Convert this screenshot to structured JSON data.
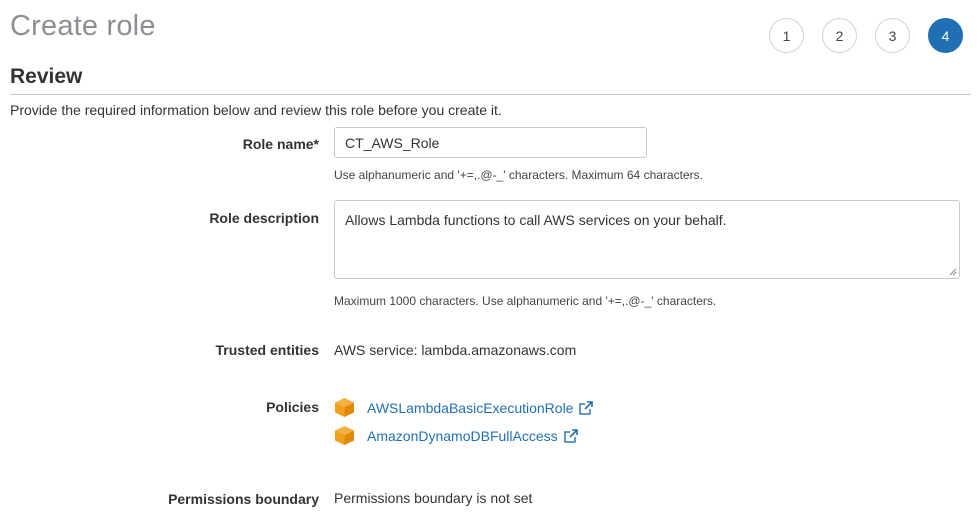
{
  "header": {
    "title": "Create role",
    "steps": [
      "1",
      "2",
      "3",
      "4"
    ],
    "active_step": "4"
  },
  "review": {
    "section_title": "Review",
    "intro": "Provide the required information below and review this role before you create it."
  },
  "role_name": {
    "label": "Role name*",
    "value": "CT_AWS_Role",
    "help": "Use alphanumeric and '+=,.@-_' characters. Maximum 64 characters."
  },
  "role_description": {
    "label": "Role description",
    "value": "Allows Lambda functions to call AWS services on your behalf.",
    "help": "Maximum 1000 characters. Use alphanumeric and '+=,.@-_' characters."
  },
  "trusted_entities": {
    "label": "Trusted entities",
    "value": "AWS service: lambda.amazonaws.com"
  },
  "policies": {
    "label": "Policies",
    "items": [
      {
        "name": "AWSLambdaBasicExecutionRole",
        "icon": "aws-policy-cube-icon"
      },
      {
        "name": "AmazonDynamoDBFullAccess",
        "icon": "aws-policy-cube-icon"
      }
    ]
  },
  "permissions_boundary": {
    "label": "Permissions boundary",
    "value": "Permissions boundary is not set"
  },
  "colors": {
    "accent": "#1f6fb2",
    "policy_icon": "#f19e1a",
    "title_gray": "#8b8f94"
  }
}
